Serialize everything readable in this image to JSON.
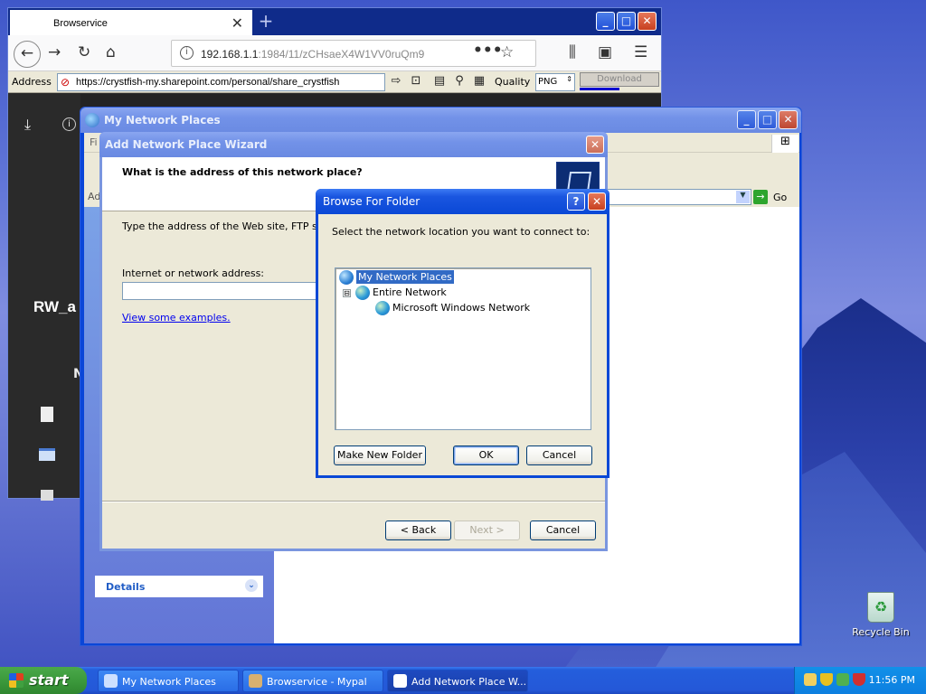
{
  "browser": {
    "tab_title": "Browservice",
    "url_host": "192.168.1.1",
    "url_path": ":1984/11/zCHsaeX4W1VV0ruQm9",
    "address_label": "Address",
    "address_value": "https://crystfish-my.sharepoint.com/personal/share_crystfish",
    "quality_label": "Quality",
    "quality_value": "PNG",
    "download_label": "Download",
    "download_progress": 0.5,
    "page_heading": "RW_a",
    "column_heading_fragment": "N"
  },
  "mnp": {
    "title": "My Network Places",
    "menu_fragment": "Fi",
    "address_fragment": "Ad",
    "go_label": "Go",
    "details_label": "Details"
  },
  "wizard": {
    "title": "Add Network Place Wizard",
    "heading": "What is the address of this network place?",
    "instruction": "Type the address of the Web site, FTP site, o",
    "address_label": "Internet or network address:",
    "address_value": "",
    "examples_link": "View some examples.",
    "back_label": "< Back",
    "next_label": "Next >",
    "cancel_label": "Cancel"
  },
  "browse": {
    "title": "Browse For Folder",
    "prompt": "Select the network location you want to connect to:",
    "tree": [
      {
        "label": "My Network Places",
        "selected": true,
        "icon": "network-places-icon"
      },
      {
        "label": "Entire Network",
        "expander": "⊟",
        "icon": "entire-network-icon"
      },
      {
        "label": "Microsoft Windows Network",
        "icon": "windows-network-icon"
      }
    ],
    "new_folder_label": "Make New Folder",
    "ok_label": "OK",
    "cancel_label": "Cancel"
  },
  "desktop": {
    "recycle_label": "Recycle Bin"
  },
  "taskbar": {
    "start_label": "start",
    "tasks": [
      "My Network Places",
      "Browservice - Mypal",
      "Add Network Place W..."
    ],
    "active_task": 2,
    "clock": "11:56 PM"
  }
}
